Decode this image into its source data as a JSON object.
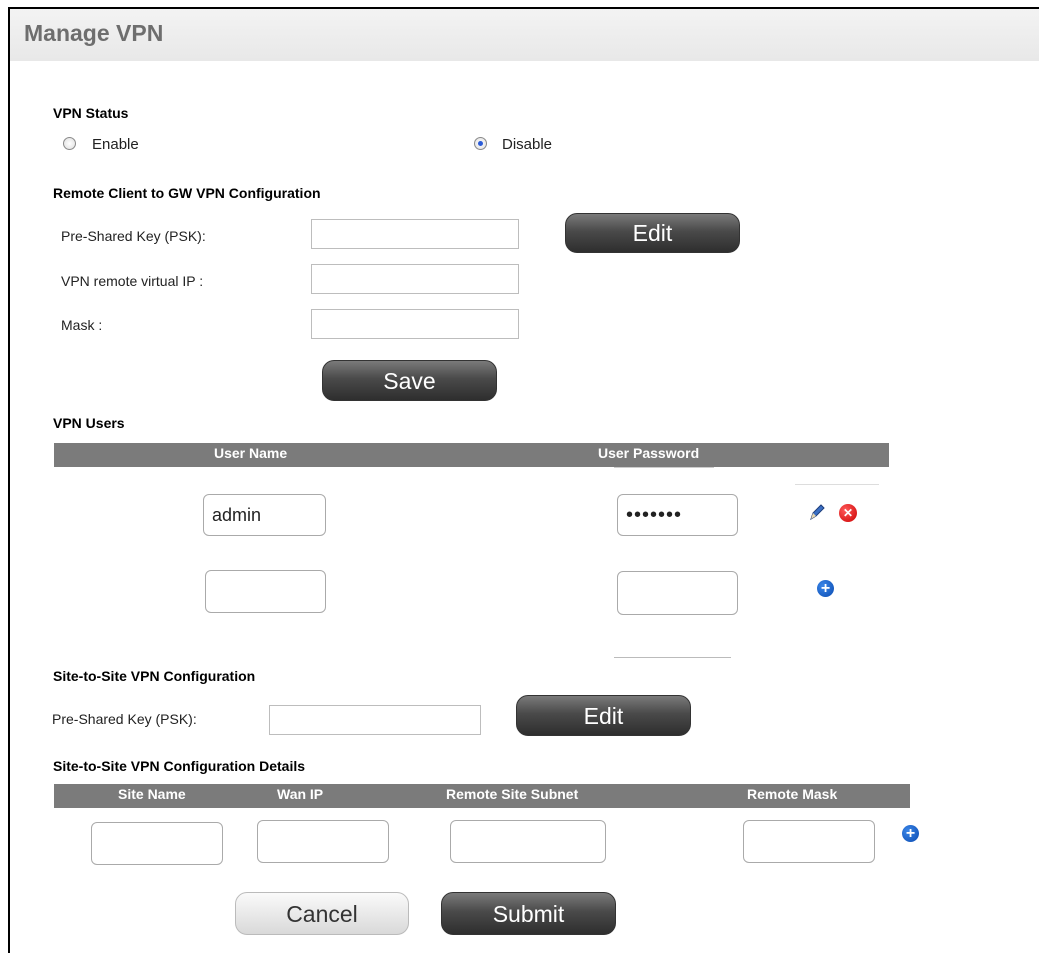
{
  "page": {
    "title": "Manage VPN"
  },
  "vpn_status": {
    "heading": "VPN Status",
    "options": [
      {
        "label": "Enable",
        "selected": false
      },
      {
        "label": "Disable",
        "selected": true
      }
    ]
  },
  "remote_client": {
    "heading": "Remote Client to GW VPN Configuration",
    "psk_label": "Pre-Shared Key (PSK):",
    "psk_value": "",
    "virtual_ip_label": "VPN remote virtual IP :",
    "virtual_ip_value": "",
    "mask_label": "Mask :",
    "mask_value": "",
    "edit_label": "Edit",
    "save_label": "Save"
  },
  "vpn_users": {
    "heading": "VPN Users",
    "columns": [
      "User Name",
      "User Password"
    ],
    "rows": [
      {
        "user_name": "admin",
        "password": "•••••••"
      },
      {
        "user_name": "",
        "password": ""
      }
    ]
  },
  "site_to_site": {
    "heading": "Site-to-Site VPN Configuration",
    "psk_label": "Pre-Shared Key (PSK):",
    "psk_value": "",
    "edit_label": "Edit"
  },
  "site_details": {
    "heading": "Site-to-Site VPN Configuration Details",
    "columns": [
      "Site Name",
      "Wan IP",
      "Remote Site Subnet",
      "Remote Mask"
    ],
    "row": {
      "site_name": "",
      "wan_ip": "",
      "remote_subnet": "",
      "remote_mask": ""
    }
  },
  "actions": {
    "cancel_label": "Cancel",
    "submit_label": "Submit"
  },
  "colors": {
    "header_gray": "#7b7b7b",
    "title_gray": "#6e6e6e",
    "plus_blue": "#0b4bb1",
    "delete_red": "#cc0000"
  },
  "icons": [
    "pencil-icon",
    "delete-icon",
    "add-icon"
  ]
}
